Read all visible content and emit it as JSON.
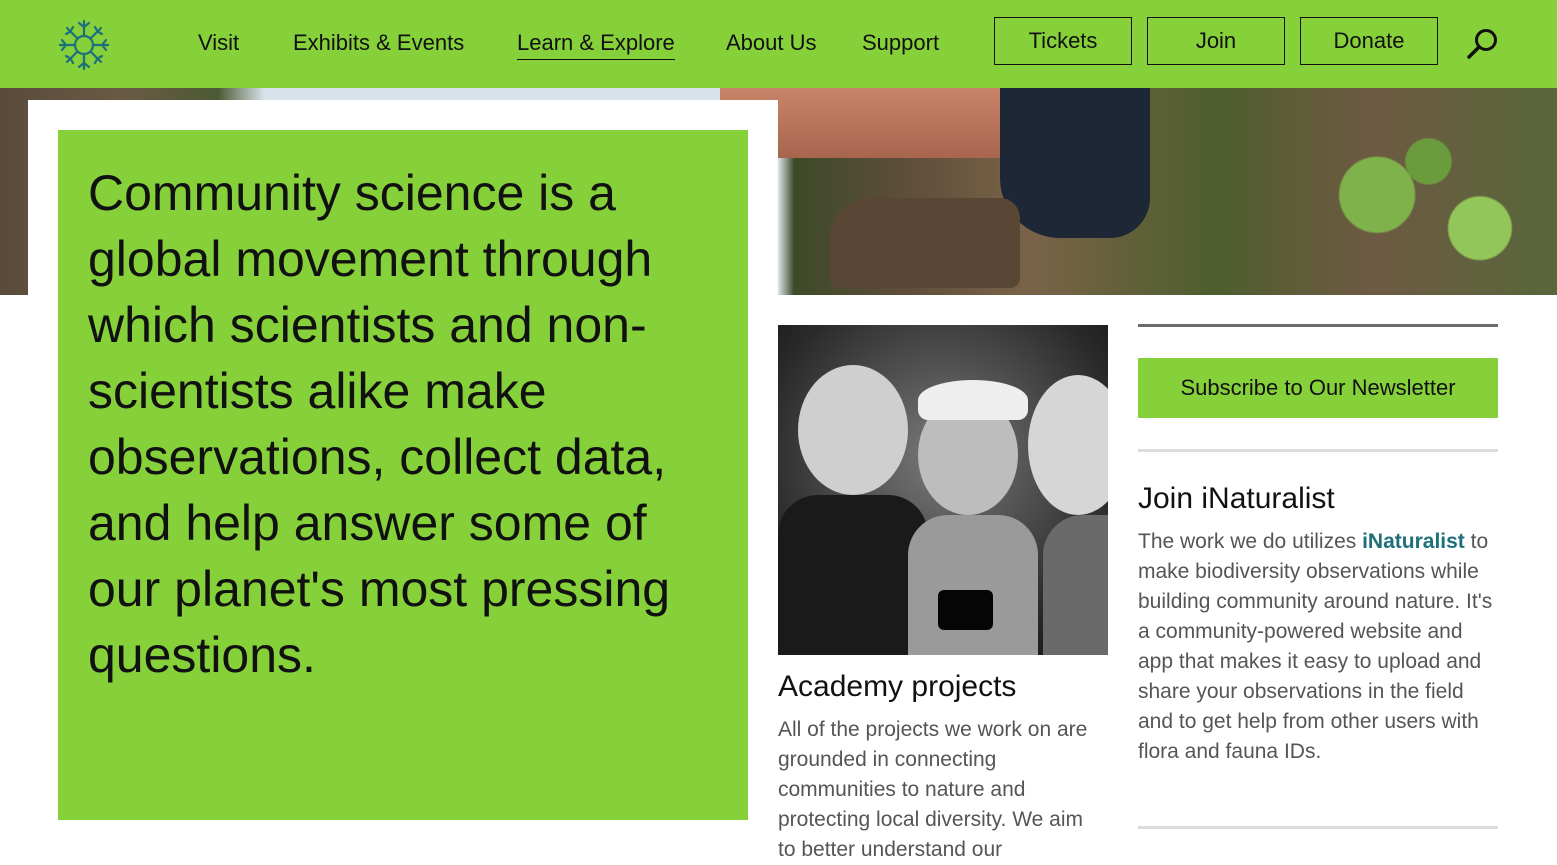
{
  "colors": {
    "brand_green": "#86d03a",
    "logo_teal": "#1d6f7a",
    "link_teal": "#1d6f7a",
    "body_gray": "#555555"
  },
  "header": {
    "logo_icon": "snowflake-logo-icon",
    "nav": [
      {
        "label": "Visit"
      },
      {
        "label": "Exhibits & Events"
      },
      {
        "label": "Learn & Explore",
        "active": true
      },
      {
        "label": "About Us"
      },
      {
        "label": "Support"
      }
    ],
    "buttons": {
      "tickets": "Tickets",
      "join": "Join",
      "donate": "Donate"
    },
    "search_icon": "search-icon"
  },
  "hero": {
    "quote": "Community science is a global movement through which scientists and non-scientists alike make observations, collect data, and help answer some of our planet's most pressing questions."
  },
  "academy": {
    "title": "Academy projects",
    "body": "All of the projects we work on are grounded in connecting communities to nature and protecting local diversity. We aim to better understand our"
  },
  "sidebar": {
    "subscribe_label": "Subscribe to Our Newsletter",
    "inat_title": "Join iNaturalist",
    "inat_body_before": "The work we do utilizes ",
    "inat_link": "iNaturalist",
    "inat_body_after": " to make biodiversity observations while building community around nature. It's a community-powered website and app that makes it easy to upload and share your observations in the field and to get help from other users with flora and fauna IDs."
  }
}
